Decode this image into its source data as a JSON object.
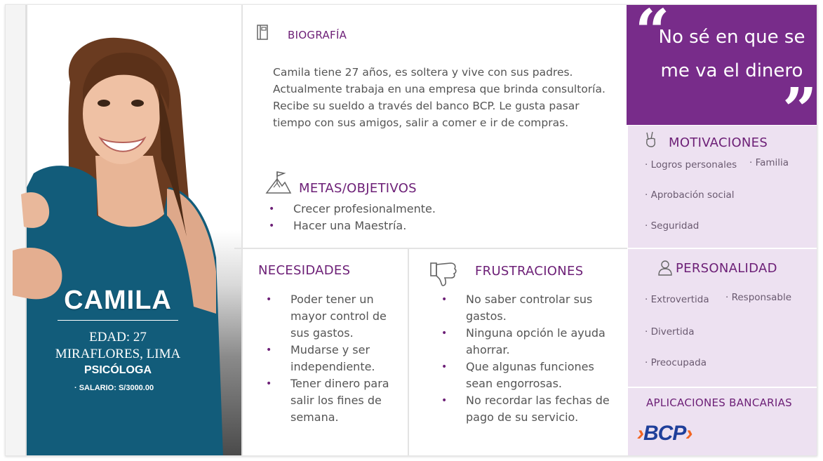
{
  "persona": {
    "name": "CAMILA",
    "age": "EDAD: 27",
    "location": "MIRAFLORES, LIMA",
    "job": "PSICÓLOGA",
    "salary": "· SALARIO: S/3000.00"
  },
  "biography": {
    "heading": "BIOGRAFÍA",
    "text": "Camila tiene 27 años,  es soltera y vive con sus padres. Actualmente trabaja en una empresa que brinda consultoría. Recibe su sueldo a través del banco BCP. Le gusta pasar tiempo con sus amigos, salir a comer e ir de compras."
  },
  "goals": {
    "heading": "METAS/OBJETIVOS",
    "items": [
      "Crecer profesionalmente.",
      "Hacer una Maestría."
    ]
  },
  "needs": {
    "heading": "NECESIDADES",
    "items": [
      "Poder tener un mayor control de sus gastos.",
      "Mudarse y ser independiente.",
      "Tener dinero para salir los fines de semana."
    ]
  },
  "frustrations": {
    "heading": "FRUSTRACIONES",
    "items": [
      "No saber controlar sus gastos.",
      "Ninguna opción le ayuda ahorrar.",
      "Que algunas funciones sean engorrosas.",
      "No recordar las fechas de pago de su servicio."
    ]
  },
  "quote": {
    "text": "No sé en que se me va el dinero",
    "open_mark": "“",
    "close_mark": "”"
  },
  "motivations": {
    "heading": "MOTIVACIONES",
    "items": [
      "Logros personales",
      "Familia",
      "Aprobación social",
      "Seguridad"
    ]
  },
  "personality": {
    "heading": "PERSONALIDAD",
    "items": [
      "Extrovertida",
      "Responsable",
      "Divertida",
      "Preocupada"
    ]
  },
  "banking_apps": {
    "heading": "APLICACIONES BANCARIAS",
    "logo_text": "BCP"
  },
  "icons": {
    "biography": "notebook-icon",
    "goals": "mountain-flag-icon",
    "frustrations": "thumbs-down-icon",
    "motivations": "peace-hand-icon",
    "personality": "person-icon"
  },
  "colors": {
    "accent": "#6d2077",
    "quote_bg": "#782c8a",
    "side_bg": "#ede1f1",
    "bcp_blue": "#1f3f9a",
    "bcp_orange": "#f26522"
  }
}
